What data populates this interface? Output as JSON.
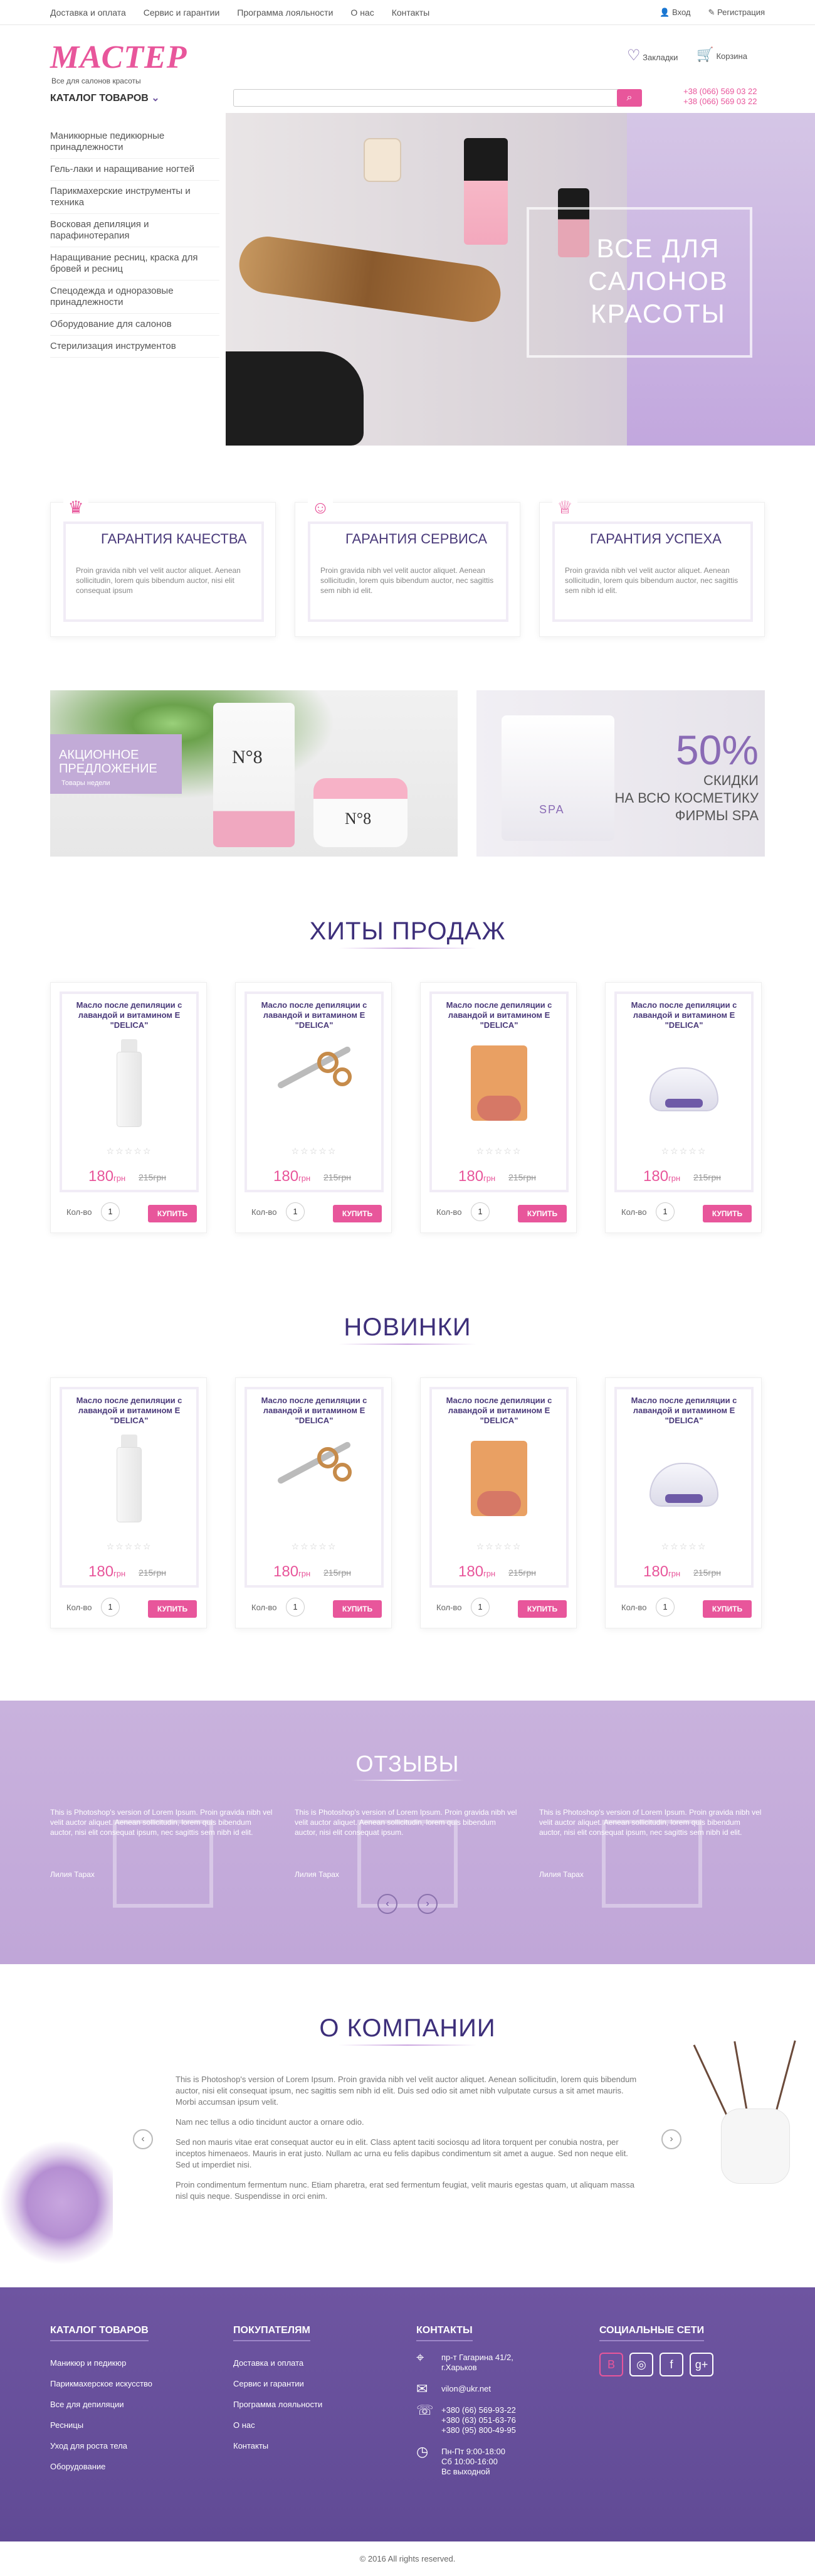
{
  "topnav": {
    "links": [
      "Доставка и оплата",
      "Сервис и гарантии",
      "Программа лояльности",
      "О нас",
      "Контакты"
    ],
    "login": "Вход",
    "register": "Регистрация"
  },
  "header": {
    "logo": "МАСТЕР",
    "tagline": "Все для салонов красоты",
    "favorites": "Закладки",
    "cart": "Корзина",
    "catalog_button": "КАТАЛОГ ТОВАРОВ",
    "search_placeholder": "",
    "phones": [
      "+38 (066) 569 03 22",
      "+38 (066) 569 03 22"
    ]
  },
  "catalog": [
    "Маникюрные педикюрные принадлежности",
    "Гель-лаки и наращивание ногтей",
    "Парикмахерские инструменты и техника",
    "Восковая депиляция и парафинотерапия",
    "Наращивание ресниц, краска для бровей и ресниц",
    "Спецодежда и одноразовые принадлежности",
    "Оборудование для салонов",
    "Стерилизация инструментов"
  ],
  "hero": {
    "line1": "ВСЕ ДЛЯ",
    "line2": "САЛОНОВ",
    "line3": "КРАСОТЫ"
  },
  "guarantees": [
    {
      "icon": "medal-icon",
      "title": "ГАРАНТИЯ КАЧЕСТВА",
      "text": "Proin gravida nibh vel velit auctor aliquet. Aenean sollicitudin, lorem quis bibendum auctor, nisi elit consequat ipsum"
    },
    {
      "icon": "person-icon",
      "title": "ГАРАНТИЯ СЕРВИСА",
      "text": "Proin gravida nibh vel velit auctor aliquet. Aenean sollicitudin, lorem quis bibendum auctor, nec sagittis sem nibh id elit."
    },
    {
      "icon": "trophy-icon",
      "title": "ГАРАНТИЯ УСПЕХА",
      "text": "Proin gravida nibh vel velit auctor aliquet. Aenean sollicitudin, lorem quis bibendum auctor, nec sagittis sem nibh id elit."
    }
  ],
  "promo_left": {
    "title1": "АКЦИОННОЕ",
    "title2": "ПРЕДЛОЖЕНИЕ",
    "sub": "Товары недели",
    "tube_label": "N°8",
    "jar_label": "N°8"
  },
  "promo_right": {
    "percent": "50%",
    "line1": "СКИДКИ",
    "line2": "НА ВСЮ КОСМЕТИКУ",
    "line3": "ФИРМЫ SPA",
    "spa_label": "SPA"
  },
  "hits": {
    "title": "ХИТЫ ПРОДАЖ",
    "products": [
      {
        "name": "Масло после депиляции с лавандой и витамином Е \"DELICA\"",
        "image": "spray-bottle-icon",
        "stars": "☆☆☆☆☆",
        "price": "180",
        "currency": "грн",
        "old_price": "215грн",
        "qty_label": "Кол-во",
        "qty": "1",
        "buy": "КУПИТЬ"
      },
      {
        "name": "Масло после депиляции с лавандой и витамином Е \"DELICA\"",
        "image": "scissors-icon",
        "stars": "☆☆☆☆☆",
        "price": "180",
        "currency": "грн",
        "old_price": "215грн",
        "qty_label": "Кол-во",
        "qty": "1",
        "buy": "КУПИТЬ"
      },
      {
        "name": "Масло после депиляции с лавандой и витамином Е \"DELICA\"",
        "image": "wax-box-icon",
        "stars": "☆☆☆☆☆",
        "price": "180",
        "currency": "грн",
        "old_price": "215грн",
        "qty_label": "Кол-во",
        "qty": "1",
        "buy": "КУПИТЬ"
      },
      {
        "name": "Масло после депиляции с лавандой и витамином Е \"DELICA\"",
        "image": "wax-heater-icon",
        "stars": "☆☆☆☆☆",
        "price": "180",
        "currency": "грн",
        "old_price": "215грн",
        "qty_label": "Кол-во",
        "qty": "1",
        "buy": "КУПИТЬ"
      }
    ]
  },
  "news": {
    "title": "НОВИНКИ",
    "products": [
      {
        "name": "Масло после депиляции с лавандой и витамином Е \"DELICA\"",
        "image": "spray-bottle-icon",
        "stars": "☆☆☆☆☆",
        "price": "180",
        "currency": "грн",
        "old_price": "215грн",
        "qty_label": "Кол-во",
        "qty": "1",
        "buy": "КУПИТЬ"
      },
      {
        "name": "Масло после депиляции с лавандой и витамином Е \"DELICA\"",
        "image": "scissors-icon",
        "stars": "☆☆☆☆☆",
        "price": "180",
        "currency": "грн",
        "old_price": "215грн",
        "qty_label": "Кол-во",
        "qty": "1",
        "buy": "КУПИТЬ"
      },
      {
        "name": "Масло после депиляции с лавандой и витамином Е \"DELICA\"",
        "image": "wax-box-icon",
        "stars": "☆☆☆☆☆",
        "price": "180",
        "currency": "грн",
        "old_price": "215грн",
        "qty_label": "Кол-во",
        "qty": "1",
        "buy": "КУПИТЬ"
      },
      {
        "name": "Масло после депиляции с лавандой и витамином Е \"DELICA\"",
        "image": "wax-heater-icon",
        "stars": "☆☆☆☆☆",
        "price": "180",
        "currency": "грн",
        "old_price": "215грн",
        "qty_label": "Кол-во",
        "qty": "1",
        "buy": "КУПИТЬ"
      }
    ]
  },
  "reviews": {
    "title": "ОТЗЫВЫ",
    "items": [
      {
        "text": "This is Photoshop's version of Lorem Ipsum. Proin gravida nibh vel velit auctor aliquet. Aenean sollicitudin, lorem quis bibendum auctor, nisi elit consequat ipsum, nec sagittis sem nibh id elit.",
        "author": "Лилия Тарах"
      },
      {
        "text": "This is Photoshop's version of Lorem Ipsum. Proin gravida nibh vel velit auctor aliquet. Aenean sollicitudin, lorem quis bibendum auctor, nisi elit consequat ipsum.",
        "author": "Лилия Тарах"
      },
      {
        "text": "This is Photoshop's version of Lorem Ipsum. Proin gravida nibh vel velit auctor aliquet. Aenean sollicitudin, lorem quis bibendum auctor, nisi elit consequat ipsum, nec sagittis sem nibh id elit.",
        "author": "Лилия Тарах"
      }
    ],
    "prev": "‹",
    "next": "›"
  },
  "about": {
    "title": "О КОМПАНИИ",
    "paragraphs": [
      "This is Photoshop's version of Lorem Ipsum. Proin gravida nibh vel velit auctor aliquet. Aenean sollicitudin, lorem quis bibendum auctor, nisi elit consequat ipsum, nec sagittis sem nibh id elit. Duis sed odio sit amet nibh vulputate cursus a sit amet mauris. Morbi accumsan ipsum velit.",
      "Nam nec tellus a odio tincidunt auctor a ornare odio.",
      "Sed non mauris vitae erat consequat auctor eu in elit. Class aptent taciti sociosqu ad litora torquent per conubia nostra, per inceptos himenaeos. Mauris in erat justo. Nullam ac urna eu felis dapibus condimentum sit amet a augue. Sed non neque elit. Sed ut imperdiet nisi.",
      "Proin condimentum fermentum nunc. Etiam pharetra, erat sed fermentum feugiat, velit mauris egestas quam, ut aliquam massa nisl quis neque. Suspendisse in orci enim."
    ],
    "prev": "‹",
    "next": "›"
  },
  "footer": {
    "col1_title": "КАТАЛОГ ТОВАРОВ",
    "col1": [
      "Маникюр и педикюр",
      "Парикмахерское искусство",
      "Все для депиляции",
      "Ресницы",
      "Уход для роста тела",
      "Оборудование"
    ],
    "col2_title": "ПОКУПАТЕЛЯМ",
    "col2": [
      "Доставка и оплата",
      "Сервис и гарантии",
      "Программа лояльности",
      "О нас",
      "Контакты"
    ],
    "col3_title": "КОНТАКТЫ",
    "address": [
      "пр-т Гагарина 41/2,",
      "г.Харьков"
    ],
    "email": "vilon@ukr.net",
    "phones": [
      "+380 (66) 569-93-22",
      "+380 (63) 051-63-76",
      "+380 (95) 800-49-95"
    ],
    "hours": [
      "Пн-Пт  9:00-18:00",
      "Сб      10:00-16:00",
      "Вс      выходной"
    ],
    "col4_title": "СОЦИАЛЬНЫЕ СЕТИ",
    "socials": [
      "vk-icon",
      "instagram-icon",
      "facebook-icon",
      "google-plus-icon"
    ]
  },
  "copyright": "© 2016   All rights reserved.",
  "colors": {
    "accent": "#e8569b",
    "purple": "#6e55a1",
    "lilac": "#c9b2dd",
    "title": "#3d2f7a"
  }
}
